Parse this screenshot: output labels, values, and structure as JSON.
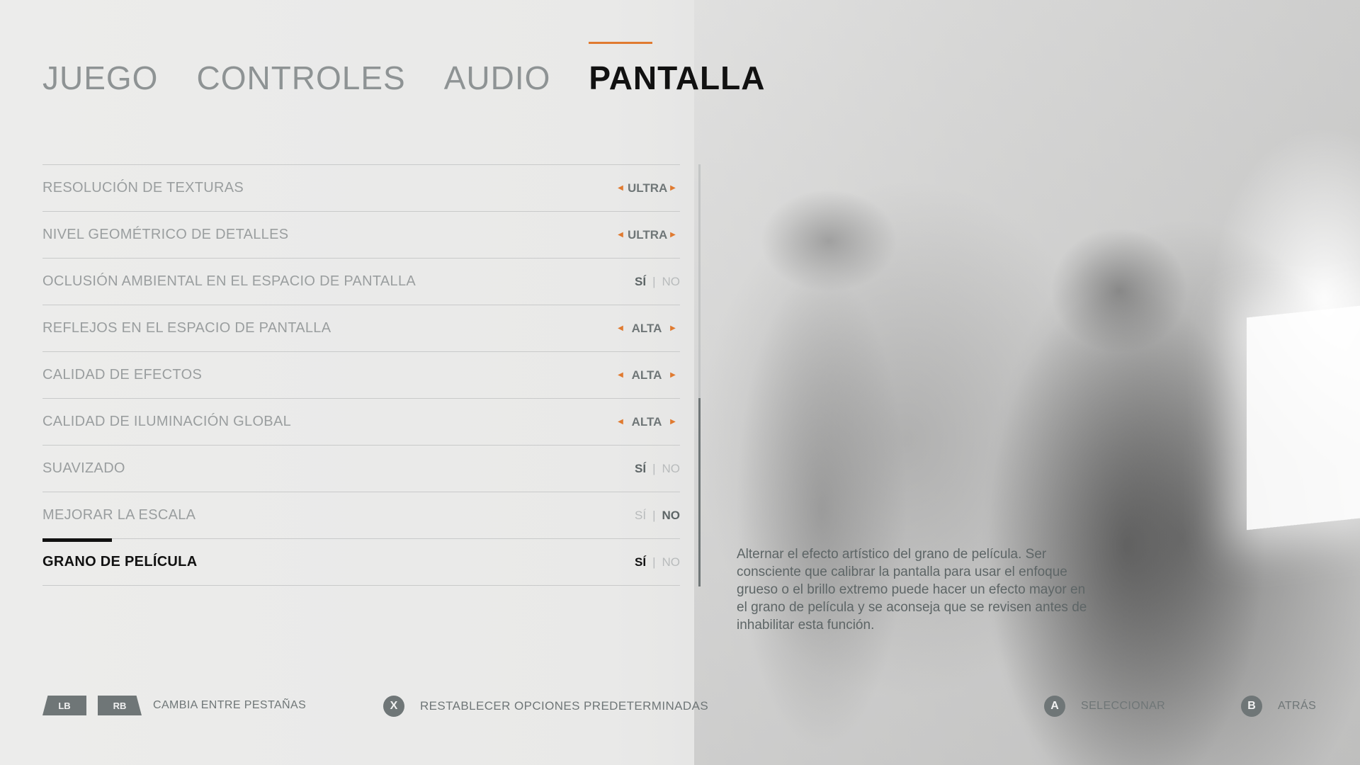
{
  "tabs": [
    {
      "label": "JUEGO",
      "active": false
    },
    {
      "label": "CONTROLES",
      "active": false
    },
    {
      "label": "AUDIO",
      "active": false
    },
    {
      "label": "PANTALLA",
      "active": true
    }
  ],
  "settings": [
    {
      "label": "RESOLUCIÓN DE TEXTURAS",
      "type": "cycle",
      "value": "ULTRA"
    },
    {
      "label": "NIVEL GEOMÉTRICO DE DETALLES",
      "type": "cycle",
      "value": "ULTRA"
    },
    {
      "label": "OCLUSIÓN AMBIENTAL EN EL ESPACIO DE PANTALLA",
      "type": "toggle",
      "on": "SÍ",
      "off": "NO",
      "state": "on"
    },
    {
      "label": "REFLEJOS EN EL ESPACIO DE PANTALLA",
      "type": "cycle",
      "value": "ALTA"
    },
    {
      "label": "CALIDAD DE EFECTOS",
      "type": "cycle",
      "value": "ALTA"
    },
    {
      "label": "CALIDAD DE ILUMINACIÓN GLOBAL",
      "type": "cycle",
      "value": "ALTA"
    },
    {
      "label": "SUAVIZADO",
      "type": "toggle",
      "on": "SÍ",
      "off": "NO",
      "state": "on"
    },
    {
      "label": "MEJORAR LA ESCALA",
      "type": "toggle",
      "on": "SÍ",
      "off": "NO",
      "state": "off"
    },
    {
      "label": "GRANO DE PELÍCULA",
      "type": "toggle",
      "on": "SÍ",
      "off": "NO",
      "state": "on",
      "selected": true
    }
  ],
  "description": "Alternar el efecto artístico del grano de película. Ser consciente que calibrar la pantalla para usar el enfoque grueso o el brillo extremo puede hacer un efecto mayor en el grano de película y se aconseja que se revisen antes de inhabilitar esta función.",
  "footer": {
    "lb": "LB",
    "rb": "RB",
    "switch_tabs": "CAMBIA ENTRE PESTAÑAS",
    "x_button": "X",
    "reset": "RESTABLECER OPCIONES PREDETERMINADAS",
    "a_button": "A",
    "select": "SELECCIONAR",
    "b_button": "B",
    "back": "ATRÁS"
  },
  "colors": {
    "accent": "#e07a30",
    "text_muted": "#9a9e9f",
    "text_active": "#111111",
    "button": "#6f7677"
  }
}
